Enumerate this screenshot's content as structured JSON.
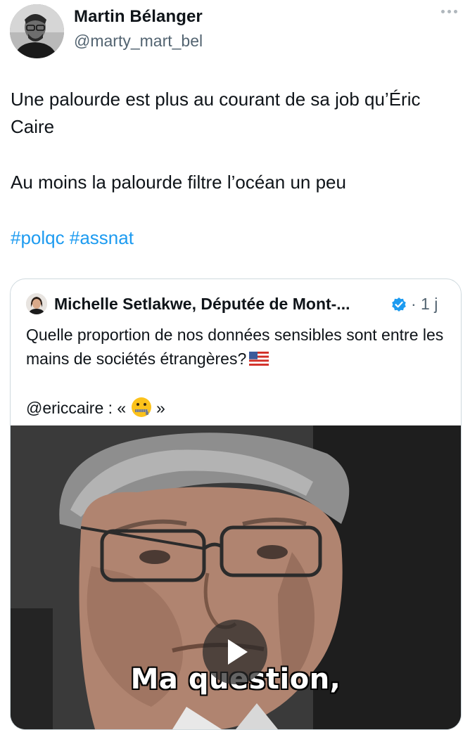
{
  "author": {
    "display_name": "Martin Bélanger",
    "handle": "@marty_mart_bel",
    "avatar": "person-portrait"
  },
  "more_menu_icon": "more-dots-icon",
  "tweet": {
    "line1": "Une palourde est plus au courant de sa job qu’Éric Caire",
    "line2": "Au moins la palourde filtre l’océan un peu",
    "hashtags": [
      "#polqc",
      "#assnat"
    ]
  },
  "quoted_tweet": {
    "display_name": "Michelle Setlakwe, Députée de Mont-...",
    "verified_icon": "verified-badge-icon",
    "time": "· 1 j",
    "text_line1": "Quelle proportion de nos données sensibles sont entre les mains de sociétés étrangères?",
    "flag_emoji": "us-flag-emoji",
    "mention_prefix": "@ericcaire : «",
    "zipper_emoji": "zipper-mouth-face-emoji",
    "mention_suffix": "»",
    "video": {
      "caption": "Ma question,",
      "play_icon": "play-icon"
    }
  },
  "colors": {
    "text": "#0f1419",
    "secondary": "#536471",
    "link": "#1d9bf0",
    "verified": "#1d9bf0",
    "border": "#cfd9de"
  }
}
